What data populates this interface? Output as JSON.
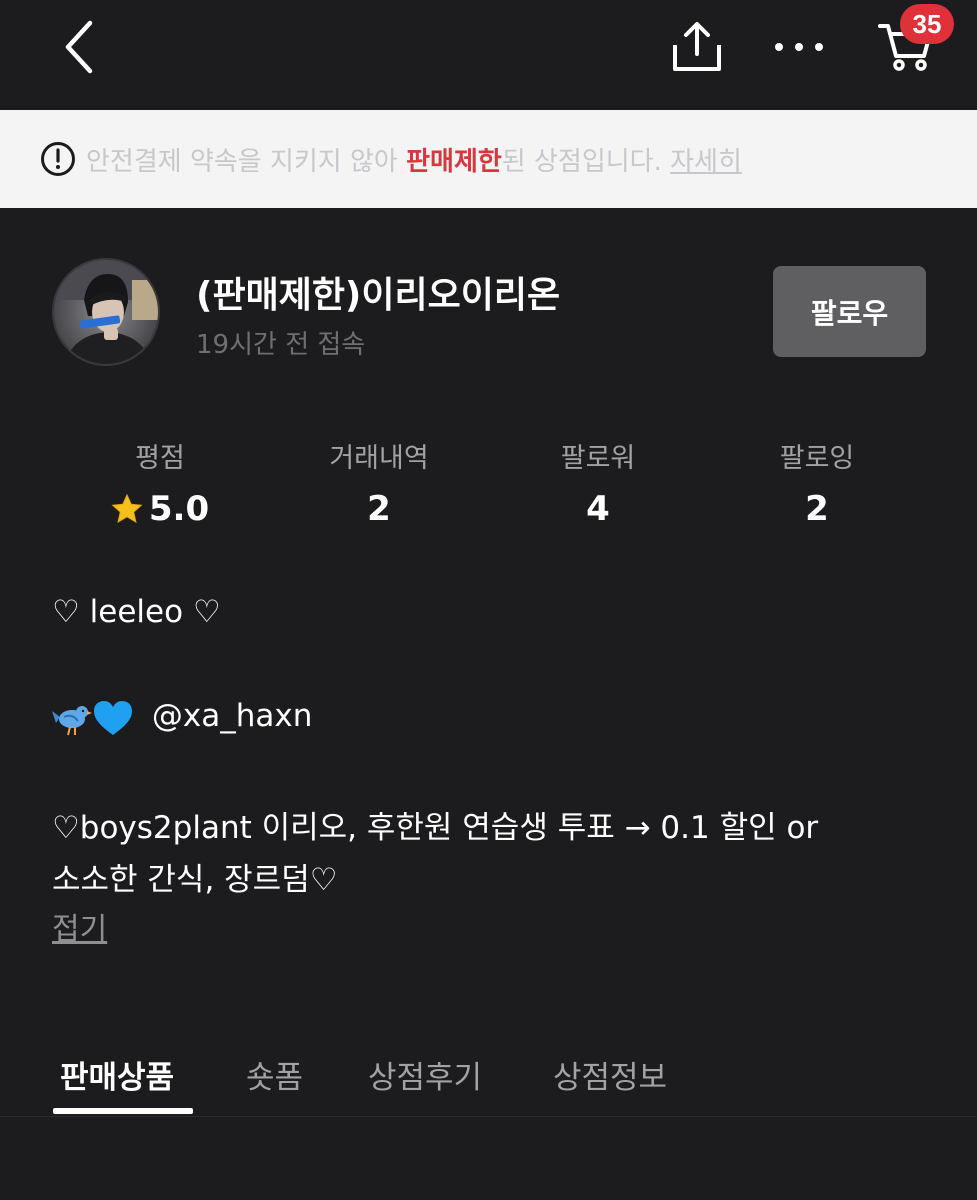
{
  "topbar": {
    "back_icon": "chevron-left-icon",
    "share_icon": "share-icon",
    "more_icon": "more-horizontal-icon",
    "cart_icon": "cart-icon",
    "cart_badge": "35"
  },
  "banner": {
    "icon": "alert-circle-icon",
    "text_before": "안전결제 약속을 지키지 않아 ",
    "highlight": "판매제한",
    "text_after": "된 상점입니다. ",
    "detail_link": "자세히",
    "highlight_color": "#d9363e"
  },
  "profile": {
    "name": "(판매제한)이리오이리온",
    "last_access": "19시간 전 접속",
    "follow_button": "팔로우"
  },
  "stats": [
    {
      "label": "평점",
      "value": "5.0",
      "icon": "star-icon"
    },
    {
      "label": "거래내역",
      "value": "2"
    },
    {
      "label": "팔로워",
      "value": "4"
    },
    {
      "label": "팔로잉",
      "value": "2"
    }
  ],
  "bio": {
    "line1": "♡ leeleo ♡",
    "line2_handle": "@xa_haxn",
    "line3": "♡boys2plant 이리오, 후한원 연습생 투표 → 0.1 할인 or",
    "line4": "소소한 간식, 장르덤♡",
    "collapse": "접기"
  },
  "tabs": [
    {
      "label": "판매상품",
      "active": true
    },
    {
      "label": "숏폼",
      "active": false
    },
    {
      "label": "상점후기",
      "active": false
    },
    {
      "label": "상점정보",
      "active": false
    }
  ]
}
